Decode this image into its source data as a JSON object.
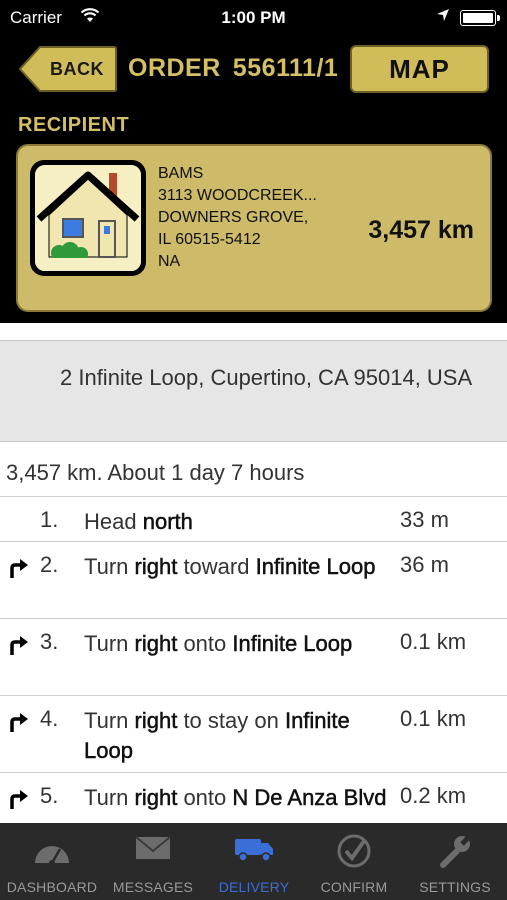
{
  "status_bar": {
    "carrier": "Carrier",
    "time": "1:00 PM"
  },
  "header": {
    "back_label": "BACK",
    "order_label": "ORDER",
    "order_number": "556111/1",
    "map_label": "MAP",
    "recipient_label": "RECIPIENT"
  },
  "recipient": {
    "lines": [
      "BAMS",
      "3113 WOODCREEK...",
      "DOWNERS GROVE,",
      "IL 60515-5412",
      "NA"
    ],
    "distance": "3,457 km",
    "icon": "house-icon"
  },
  "destination": {
    "address": "2 Infinite Loop, Cupertino, CA 95014, USA"
  },
  "route_summary": "3,457 km. About 1 day 7 hours",
  "steps": [
    {
      "number": "1.",
      "turn": false,
      "parts": [
        "Head ",
        "north",
        ""
      ],
      "distance": "33 m"
    },
    {
      "number": "2.",
      "turn": true,
      "parts": [
        "Turn ",
        "right",
        " toward ",
        "Infinite Loop"
      ],
      "distance": "36 m"
    },
    {
      "number": "3.",
      "turn": true,
      "parts": [
        "Turn ",
        "right",
        " onto ",
        "Infinite Loop"
      ],
      "distance": "0.1 km"
    },
    {
      "number": "4.",
      "turn": true,
      "parts": [
        "Turn ",
        "right",
        " to stay on ",
        "Infinite Loop"
      ],
      "distance": "0.1 km"
    },
    {
      "number": "5.",
      "turn": true,
      "parts": [
        "Turn ",
        "right",
        " onto ",
        "N De Anza Blvd"
      ],
      "distance": "0.2 km"
    }
  ],
  "tabs": [
    {
      "label": "DASHBOARD",
      "icon": "gauge-icon",
      "active": false
    },
    {
      "label": "MESSAGES",
      "icon": "envelope-icon",
      "active": false
    },
    {
      "label": "DELIVERY",
      "icon": "truck-icon",
      "active": true
    },
    {
      "label": "CONFIRM",
      "icon": "checkmark-icon",
      "active": false
    },
    {
      "label": "SETTINGS",
      "icon": "wrench-icon",
      "active": false
    }
  ],
  "colors": {
    "gold": "#d4bf66",
    "card": "#cdbb6a",
    "active_tab": "#3a6fd8"
  }
}
